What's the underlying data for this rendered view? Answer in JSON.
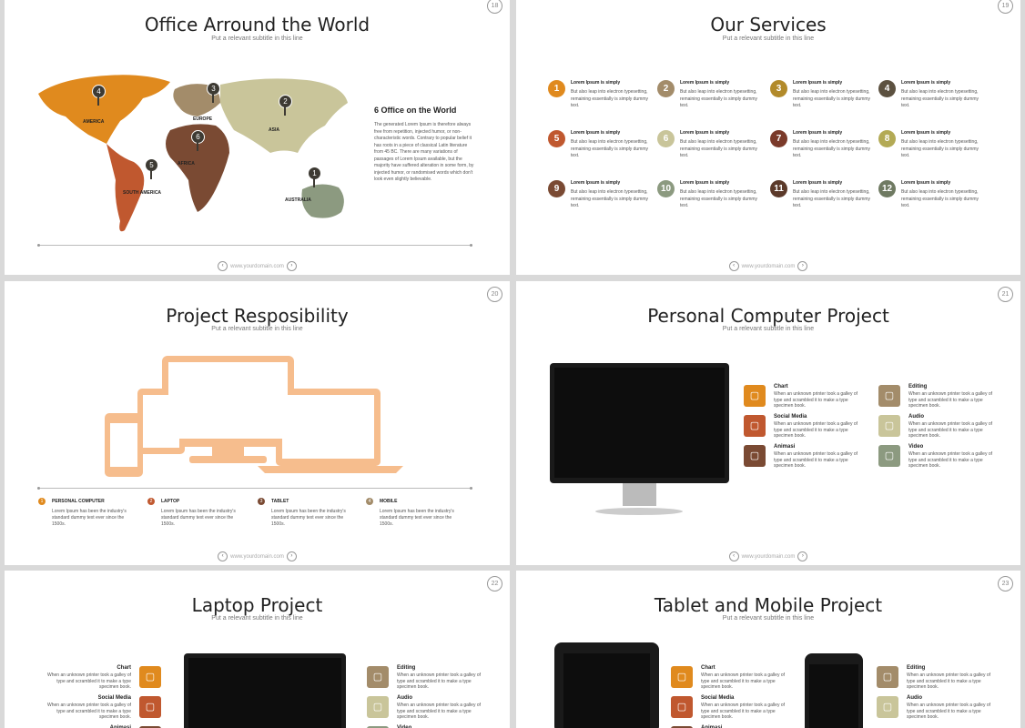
{
  "colors": {
    "orange": "#e08a1e",
    "brown": "#7a4a33",
    "tan": "#a38c6a",
    "olive": "#c9c59a",
    "dark": "#3d3a33",
    "red": "#c0582f",
    "sage": "#8c9a80",
    "gold": "#b28a2a",
    "darkred": "#7b3a2a"
  },
  "slides": {
    "s18": {
      "page": "18",
      "title": "Office Arround the World",
      "subtitle": "Put a relevant subtitle in this line",
      "side_heading": "6 Office on the World",
      "side_text": "The generated Lorem Ipsum is therefore always free from repetition, injected humor, or non-characteristic words. Contrary to popular belief it has roots in a piece of classical Latin literature from 45 BC. There are many variations of passages of Lorem Ipsum available, but the majority have suffered alteration in some form, by injected humor, or randomised words which don't look even slightly believable.",
      "footer": "www.yourdomain.com",
      "pins": [
        "4",
        "3",
        "2",
        "6",
        "5",
        "1"
      ],
      "regions": [
        "AMERICA",
        "EUROPE",
        "ASIA",
        "AFRICA",
        "SOUTH AMERICA",
        "AUSTRALIA"
      ]
    },
    "s19": {
      "page": "19",
      "title": "Our Services",
      "subtitle": "Put a relevant subtitle in this line",
      "footer": "www.yourdomain.com",
      "items": [
        {
          "n": "1",
          "h": "Lorem Ipsum is simply",
          "t": "But also leap into electron typesetting, remaining essentially is simply dummy text."
        },
        {
          "n": "2",
          "h": "Lorem Ipsum is simply",
          "t": "But also leap into electron typesetting, remaining essentially is simply dummy text."
        },
        {
          "n": "3",
          "h": "Lorem Ipsum is simply",
          "t": "But also leap into electron typesetting, remaining essentially is simply dummy text."
        },
        {
          "n": "4",
          "h": "Lorem Ipsum is simply",
          "t": "But also leap into electron typesetting, remaining essentially is simply dummy text."
        },
        {
          "n": "5",
          "h": "Lorem Ipsum is simply",
          "t": "But also leap into electron typesetting, remaining essentially is simply dummy text."
        },
        {
          "n": "6",
          "h": "Lorem Ipsum is simply",
          "t": "But also leap into electron typesetting, remaining essentially is simply dummy text."
        },
        {
          "n": "7",
          "h": "Lorem Ipsum is simply",
          "t": "But also leap into electron typesetting, remaining essentially is simply dummy text."
        },
        {
          "n": "8",
          "h": "Lorem Ipsum is simply",
          "t": "But also leap into electron typesetting, remaining essentially is simply dummy text."
        },
        {
          "n": "9",
          "h": "Lorem Ipsum is simply",
          "t": "But also leap into electron typesetting, remaining essentially is simply dummy text."
        },
        {
          "n": "10",
          "h": "Lorem Ipsum is simply",
          "t": "But also leap into electron typesetting, remaining essentially is simply dummy text."
        },
        {
          "n": "11",
          "h": "Lorem Ipsum is simply",
          "t": "But also leap into electron typesetting, remaining essentially is simply dummy text."
        },
        {
          "n": "12",
          "h": "Lorem Ipsum is simply",
          "t": "But also leap into electron typesetting, remaining essentially is simply dummy text."
        }
      ]
    },
    "s20": {
      "page": "20",
      "title": "Project Resposibility",
      "subtitle": "Put a relevant subtitle in this line",
      "footer": "www.yourdomain.com",
      "items": [
        {
          "n": "1",
          "h": "PERSONAL COMPUTER",
          "t": "Lorem Ipsum has been the industry's standard dummy text ever since the 1500s."
        },
        {
          "n": "2",
          "h": "LAPTOP",
          "t": "Lorem Ipsum has been the industry's standard dummy text ever since the 1500s."
        },
        {
          "n": "3",
          "h": "TABLET",
          "t": "Lorem Ipsum has been the industry's standard dummy text ever since the 1500s."
        },
        {
          "n": "4",
          "h": "MOBILE",
          "t": "Lorem Ipsum has been the industry's standard dummy text ever since the 1500s."
        }
      ]
    },
    "s21": {
      "page": "21",
      "title": "Personal Computer Project",
      "subtitle": "Put a relevant subtitle in this line",
      "footer": "www.yourdomain.com",
      "left": [
        {
          "h": "Chart",
          "t": "When an unknown printer took a galley of type and scrambled it to make a type specimen book."
        },
        {
          "h": "Social Media",
          "t": "When an unknown printer took a galley of type and scrambled it to make a type specimen book."
        },
        {
          "h": "Animasi",
          "t": "When an unknown printer took a galley of type and scrambled it to make a type specimen book."
        }
      ],
      "right": [
        {
          "h": "Editing",
          "t": "When an unknown printer took a galley of type and scrambled it to make a type specimen book."
        },
        {
          "h": "Audio",
          "t": "When an unknown printer took a galley of type and scrambled it to make a type specimen book."
        },
        {
          "h": "Video",
          "t": "When an unknown printer took a galley of type and scrambled it to make a type specimen book."
        }
      ]
    },
    "s22": {
      "page": "22",
      "title": "Laptop Project",
      "subtitle": "Put a relevant subtitle in this line",
      "left": [
        {
          "h": "Chart",
          "t": "When an unknown printer took a galley of type and scrambled it to make a type specimen book."
        },
        {
          "h": "Social Media",
          "t": "When an unknown printer took a galley of type and scrambled it to make a type specimen book."
        },
        {
          "h": "Animasi",
          "t": ""
        }
      ],
      "right": [
        {
          "h": "Editing",
          "t": "When an unknown printer took a galley of type and scrambled it to make a type specimen book."
        },
        {
          "h": "Audio",
          "t": "When an unknown printer took a galley of type and scrambled it to make a type specimen book."
        },
        {
          "h": "Video",
          "t": ""
        }
      ]
    },
    "s23": {
      "page": "23",
      "title": "Tablet and Mobile Project",
      "subtitle": "Put a relevant subtitle in this line",
      "left": [
        {
          "h": "Chart",
          "t": "When an unknown printer took a galley of type and scrambled it to make a type specimen book."
        },
        {
          "h": "Social Media",
          "t": "When an unknown printer took a galley of type and scrambled it to make a type specimen book."
        },
        {
          "h": "Animasi",
          "t": ""
        }
      ],
      "right": [
        {
          "h": "Editing",
          "t": "When an unknown printer took a galley of type and scrambled it to make a type specimen book."
        },
        {
          "h": "Audio",
          "t": "When an unknown printer took a galley of type and scrambled it to make a type specimen book."
        }
      ]
    }
  }
}
